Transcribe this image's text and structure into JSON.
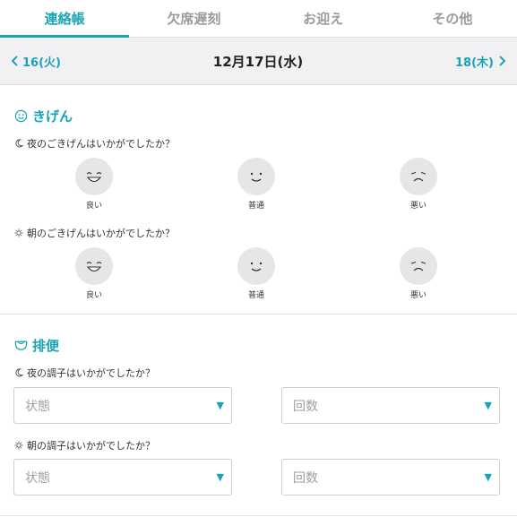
{
  "tabs": [
    {
      "label": "連絡帳",
      "active": true
    },
    {
      "label": "欠席遅刻",
      "active": false
    },
    {
      "label": "お迎え",
      "active": false
    },
    {
      "label": "その他",
      "active": false
    }
  ],
  "datebar": {
    "prev_label": "16(火)",
    "title": "12月17日(水)",
    "next_label": "18(木)"
  },
  "mood": {
    "title": "きげん",
    "night": {
      "question": "夜のごきげんはいかがでしたか？",
      "options": [
        "良い",
        "普通",
        "悪い"
      ]
    },
    "morning": {
      "question": "朝のごきげんはいかがでしたか？",
      "options": [
        "良い",
        "普通",
        "悪い"
      ]
    }
  },
  "excretion": {
    "title": "排便",
    "night": {
      "question": "夜の調子はいかがでしたか？",
      "state_placeholder": "状態",
      "count_placeholder": "回数"
    },
    "morning": {
      "question": "朝の調子はいかがでしたか？",
      "state_placeholder": "状態",
      "count_placeholder": "回数"
    }
  },
  "colors": {
    "accent": "#1aa3b4",
    "face_bg": "#e6e6e8",
    "datebar_bg": "#f1f1f3"
  }
}
